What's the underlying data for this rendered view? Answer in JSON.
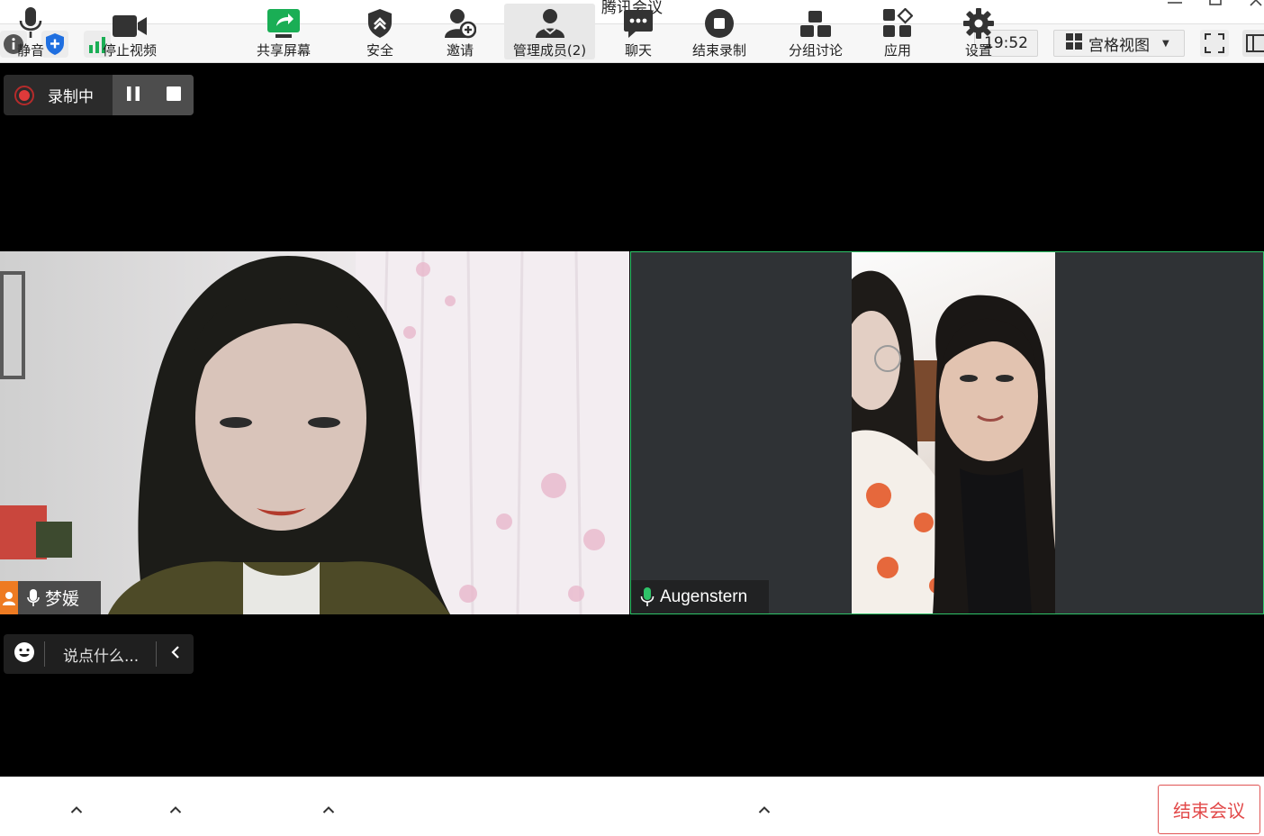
{
  "window": {
    "title": "腾讯会议",
    "controls": [
      "minimize",
      "maximize",
      "close"
    ]
  },
  "info_bar": {
    "icons": [
      "info-icon",
      "shield-icon",
      "signal-icon"
    ],
    "clock": "19:52",
    "view_mode": {
      "label": "宫格视图",
      "icon": "grid-icon"
    },
    "right_icons": [
      "fullscreen-icon",
      "side-panel-icon"
    ]
  },
  "recording": {
    "label": "录制中",
    "status_color": "#e03a3a",
    "buttons": [
      "pause-icon",
      "stop-icon"
    ]
  },
  "participants": [
    {
      "name": "梦媛",
      "role": "host",
      "mic": "on"
    },
    {
      "name": "Augenstern",
      "mic": "on"
    }
  ],
  "chat": {
    "placeholder": "说点什么..."
  },
  "toolbar": {
    "buttons": [
      {
        "label": "静音",
        "icon": "microphone-icon",
        "has_menu": true
      },
      {
        "label": "停止视频",
        "icon": "video-camera-icon",
        "has_menu": true
      },
      {
        "label": "共享屏幕",
        "icon": "share-screen-icon",
        "has_menu": true
      },
      {
        "label": "安全",
        "icon": "security-shield-icon"
      },
      {
        "label": "邀请",
        "icon": "invite-user-icon"
      },
      {
        "label": "管理成员(2)",
        "icon": "members-icon",
        "active": true
      },
      {
        "label": "聊天",
        "icon": "chat-icon"
      },
      {
        "label": "结束录制",
        "icon": "stop-record-icon",
        "has_menu": true
      },
      {
        "label": "分组讨论",
        "icon": "breakout-rooms-icon"
      },
      {
        "label": "应用",
        "icon": "apps-icon"
      },
      {
        "label": "设置",
        "icon": "settings-gear-icon"
      }
    ],
    "end_meeting": "结束会议"
  },
  "colors": {
    "active_speaker_border": "#2fc469",
    "end_button": "#e24a4a",
    "share_icon": "#1aae55",
    "host_badge": "#ee7b22"
  }
}
